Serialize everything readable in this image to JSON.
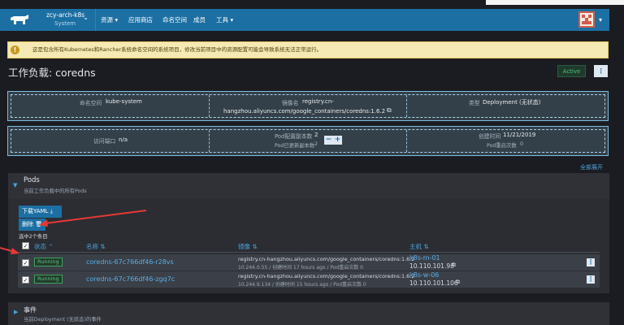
{
  "nav": {
    "cluster_name": "zcy-arch-k8s",
    "cluster_sub": "System",
    "items": [
      "资源",
      "应用商店",
      "命名空间",
      "成员",
      "工具"
    ]
  },
  "warning": "这是包含所有Kubernetes和Rancher系统命名空间的系统项目，修改当前项目中的资源配置可能会导致系统无法正常运行。",
  "page": {
    "title": "工作负载: coredns",
    "status": "Active"
  },
  "info1": {
    "ns_label": "命名空间",
    "ns_value": "kube-system",
    "image_label": "镜像名",
    "image_value_1": "registry.cn-",
    "image_value_2": "hangzhou.aliyuncs.com/google_containers/coredns:1.6.2",
    "type_label": "类型",
    "type_value": "Deployment (无状态)"
  },
  "info2": {
    "port_label": "访问端口",
    "port_value": "n/a",
    "replicas_label": "Pod配置副本数",
    "replicas_value": "2",
    "updated_label": "Pod已更新副本数",
    "updated_value": "2",
    "created_label": "创建时间",
    "created_value": "11/21/2019",
    "restarts_label": "Pod重启次数",
    "restarts_value": "0"
  },
  "expand_all": "全部展开",
  "pods": {
    "title": "Pods",
    "subtitle": "当前工作负载中的所有Pods",
    "download_btn": "下载YAML",
    "delete_btn": "删除",
    "selected_text": "选中2个条目",
    "headers": {
      "state": "状态",
      "name": "名称",
      "image": "镜像",
      "node": "主机"
    },
    "rows": [
      {
        "state": "Running",
        "name": "coredns-67c766df46-r28vs",
        "image": "registry.cn-hangzhou.aliyuncs.com/google_containers/coredns:1.6.2",
        "meta": "10.244.0.55 / 创建时间 17 hours ago / Pod重启次数 0",
        "node": "k8s-m-01",
        "node_ip": "10.110.101.98"
      },
      {
        "state": "Running",
        "name": "coredns-67c766df46-zgq7c",
        "image": "registry.cn-hangzhou.aliyuncs.com/google_containers/coredns:1.6.2",
        "meta": "10.244.9.134 / 创建时间 15 hours ago / Pod重启次数 0",
        "node": "k8s-w-06",
        "node_ip": "10.110.101.106"
      }
    ]
  },
  "events": {
    "title": "事件",
    "subtitle": "当前Deployment (无状态)的事件"
  },
  "colors": {
    "nav": "#1c6fa3",
    "accent": "#4aa3df",
    "running": "#57c27c",
    "warning_bg": "#f5e9b4",
    "arrow": "#e53935"
  }
}
